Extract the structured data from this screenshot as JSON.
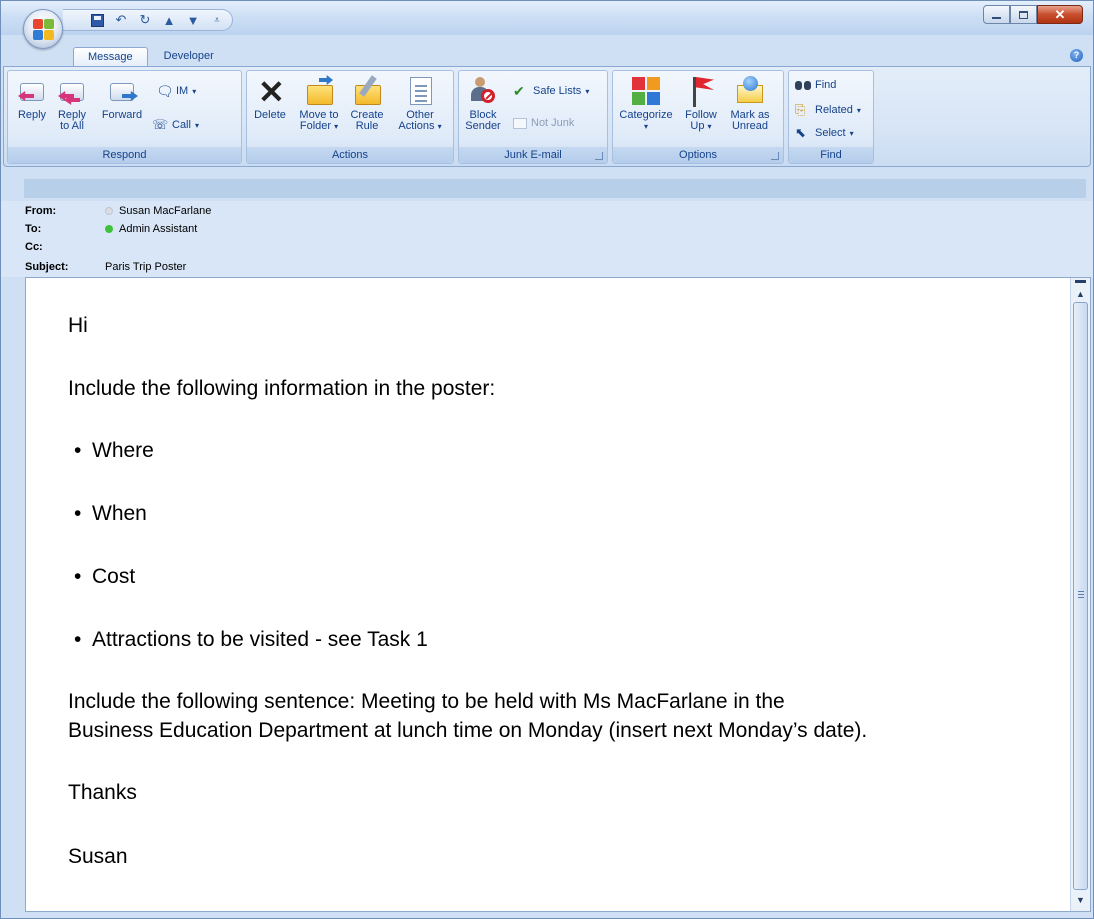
{
  "tabs": [
    {
      "label": "Message",
      "active": true
    },
    {
      "label": "Developer",
      "active": false
    }
  ],
  "ribbon": {
    "respond": {
      "label": "Respond",
      "reply": "Reply",
      "reply_all_1": "Reply",
      "reply_all_2": "to All",
      "forward": "Forward",
      "im": "IM",
      "call": "Call"
    },
    "actions": {
      "label": "Actions",
      "delete": "Delete",
      "move_1": "Move to",
      "move_2": "Folder",
      "create_1": "Create",
      "create_2": "Rule",
      "other_1": "Other",
      "other_2": "Actions"
    },
    "junk": {
      "label": "Junk E-mail",
      "block_1": "Block",
      "block_2": "Sender",
      "safe_lists": "Safe Lists",
      "not_junk": "Not Junk"
    },
    "options": {
      "label": "Options",
      "categorize": "Categorize",
      "follow_1": "Follow",
      "follow_2": "Up",
      "mark_1": "Mark as",
      "mark_2": "Unread"
    },
    "find": {
      "label": "Find",
      "find": "Find",
      "related": "Related",
      "select": "Select"
    }
  },
  "header": {
    "from_label": "From:",
    "from_value": "Susan MacFarlane",
    "to_label": "To:",
    "to_value": "Admin Assistant",
    "cc_label": "Cc:",
    "cc_value": "",
    "subject_label": "Subject:",
    "subject_value": "Paris Trip Poster"
  },
  "body": {
    "greeting": "Hi",
    "intro": "Include the following information in the poster:",
    "bullets": [
      "Where",
      "When",
      "Cost",
      "Attractions to be visited - see Task 1"
    ],
    "sentence_1": "Include the following sentence: Meeting to be held with Ms MacFarlane in the",
    "sentence_2": "Business Education Department at lunch time on Monday (insert next Monday’s date).",
    "thanks": "Thanks",
    "signature": "Susan"
  },
  "colors": {
    "presence_from": "#d9dde3",
    "presence_to": "#3fc23a",
    "accent": "#15428b"
  },
  "icons": {
    "bullet": "•",
    "dropdown": "▾",
    "help": "?"
  }
}
